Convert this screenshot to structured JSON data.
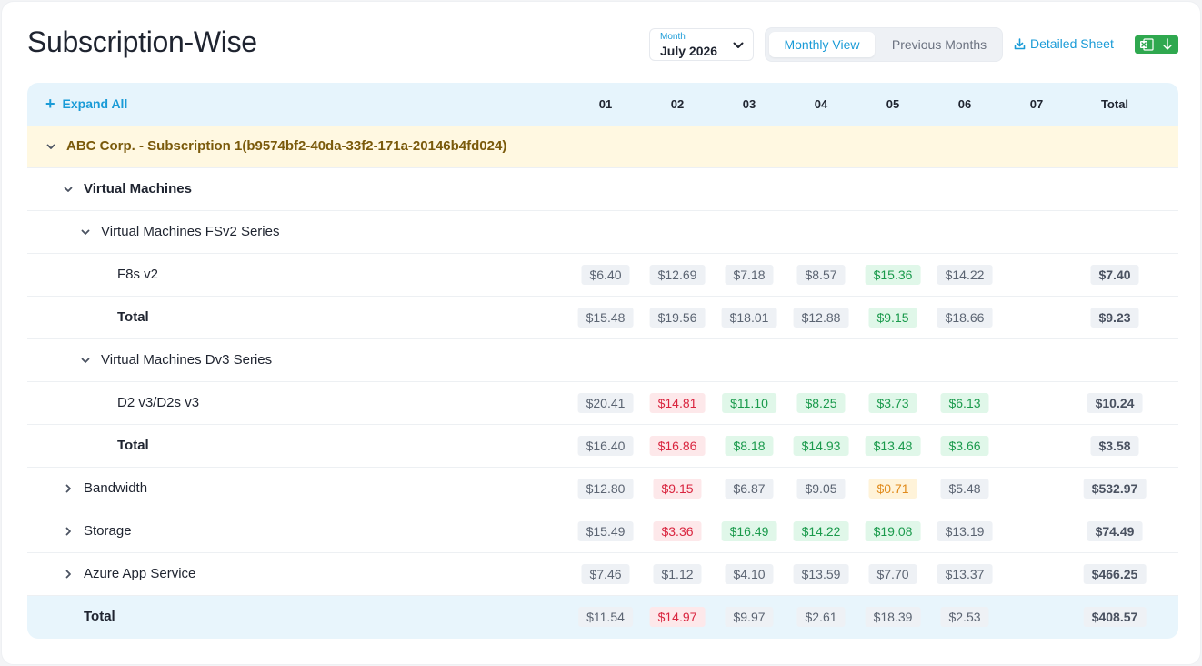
{
  "page": {
    "title": "Subscription-Wise",
    "month_caption": "Month",
    "month_value": "July 2026",
    "view_tabs": [
      "Monthly View",
      "Previous Months"
    ],
    "active_tab": "Monthly View",
    "detailed_sheet_label": "Detailed Sheet",
    "excel_icon": "excel-icon",
    "download_icon": "download-icon"
  },
  "table": {
    "expand_all_label": "Expand All",
    "columns": [
      "01",
      "02",
      "03",
      "04",
      "05",
      "06",
      "07",
      "Total"
    ],
    "rows": [
      {
        "label": "ABC Corp. - Subscription 1(b9574bf2-40da-33f2-171a-20146b4fd024)",
        "kind": "group",
        "level": 0,
        "toggle": "expanded",
        "cells": []
      },
      {
        "label": "Virtual Machines",
        "kind": "category",
        "level": 1,
        "toggle": "expanded",
        "cells": []
      },
      {
        "label": "Virtual Machines FSv2 Series",
        "kind": "series",
        "level": 2,
        "toggle": "expanded",
        "cells": []
      },
      {
        "label": "F8s v2",
        "kind": "item",
        "level": 3,
        "toggle": "none",
        "cells": [
          {
            "v": "$6.40",
            "s": "gray"
          },
          {
            "v": "$12.69",
            "s": "gray"
          },
          {
            "v": "$7.18",
            "s": "gray"
          },
          {
            "v": "$8.57",
            "s": "gray"
          },
          {
            "v": "$15.36",
            "s": "green"
          },
          {
            "v": "$14.22",
            "s": "gray"
          },
          {
            "v": "$7.40",
            "s": "total"
          }
        ]
      },
      {
        "label": "Total",
        "kind": "subtotal",
        "level": 3,
        "toggle": "none",
        "cells": [
          {
            "v": "$15.48",
            "s": "gray"
          },
          {
            "v": "$19.56",
            "s": "gray"
          },
          {
            "v": "$18.01",
            "s": "gray"
          },
          {
            "v": "$12.88",
            "s": "gray"
          },
          {
            "v": "$9.15",
            "s": "green"
          },
          {
            "v": "$18.66",
            "s": "gray"
          },
          {
            "v": "$9.23",
            "s": "total"
          }
        ]
      },
      {
        "label": "Virtual Machines Dv3 Series",
        "kind": "series",
        "level": 2,
        "toggle": "expanded",
        "cells": []
      },
      {
        "label": "D2 v3/D2s v3",
        "kind": "item",
        "level": 3,
        "toggle": "none",
        "cells": [
          {
            "v": "$20.41",
            "s": "gray"
          },
          {
            "v": "$14.81",
            "s": "red"
          },
          {
            "v": "$11.10",
            "s": "green"
          },
          {
            "v": "$8.25",
            "s": "green"
          },
          {
            "v": "$3.73",
            "s": "green"
          },
          {
            "v": "$6.13",
            "s": "green"
          },
          {
            "v": "$10.24",
            "s": "total"
          }
        ]
      },
      {
        "label": "Total",
        "kind": "subtotal",
        "level": 3,
        "toggle": "none",
        "cells": [
          {
            "v": "$16.40",
            "s": "gray"
          },
          {
            "v": "$16.86",
            "s": "red"
          },
          {
            "v": "$8.18",
            "s": "green"
          },
          {
            "v": "$14.93",
            "s": "green"
          },
          {
            "v": "$13.48",
            "s": "green"
          },
          {
            "v": "$3.66",
            "s": "green"
          },
          {
            "v": "$3.58",
            "s": "total"
          }
        ]
      },
      {
        "label": "Bandwidth",
        "kind": "collapsed",
        "level": 1,
        "toggle": "collapsed",
        "cells": [
          {
            "v": "$12.80",
            "s": "gray"
          },
          {
            "v": "$9.15",
            "s": "red"
          },
          {
            "v": "$6.87",
            "s": "gray"
          },
          {
            "v": "$9.05",
            "s": "gray"
          },
          {
            "v": "$0.71",
            "s": "orange"
          },
          {
            "v": "$5.48",
            "s": "gray"
          },
          {
            "v": "$532.97",
            "s": "total"
          }
        ]
      },
      {
        "label": "Storage",
        "kind": "collapsed",
        "level": 1,
        "toggle": "collapsed",
        "cells": [
          {
            "v": "$15.49",
            "s": "gray"
          },
          {
            "v": "$3.36",
            "s": "red"
          },
          {
            "v": "$16.49",
            "s": "green"
          },
          {
            "v": "$14.22",
            "s": "green"
          },
          {
            "v": "$19.08",
            "s": "green"
          },
          {
            "v": "$13.19",
            "s": "gray"
          },
          {
            "v": "$74.49",
            "s": "total"
          }
        ]
      },
      {
        "label": "Azure App Service",
        "kind": "collapsed",
        "level": 1,
        "toggle": "collapsed",
        "cells": [
          {
            "v": "$7.46",
            "s": "gray"
          },
          {
            "v": "$1.12",
            "s": "gray"
          },
          {
            "v": "$4.10",
            "s": "gray"
          },
          {
            "v": "$13.59",
            "s": "gray"
          },
          {
            "v": "$7.70",
            "s": "gray"
          },
          {
            "v": "$13.37",
            "s": "gray"
          },
          {
            "v": "$466.25",
            "s": "total"
          }
        ]
      },
      {
        "label": "Total",
        "kind": "grandtotal",
        "level": 1,
        "toggle": "none",
        "cells": [
          {
            "v": "$11.54",
            "s": "gray"
          },
          {
            "v": "$14.97",
            "s": "red"
          },
          {
            "v": "$9.97",
            "s": "gray"
          },
          {
            "v": "$2.61",
            "s": "gray"
          },
          {
            "v": "$18.39",
            "s": "gray"
          },
          {
            "v": "$2.53",
            "s": "gray"
          },
          {
            "v": "$408.57",
            "s": "total"
          }
        ]
      }
    ]
  }
}
